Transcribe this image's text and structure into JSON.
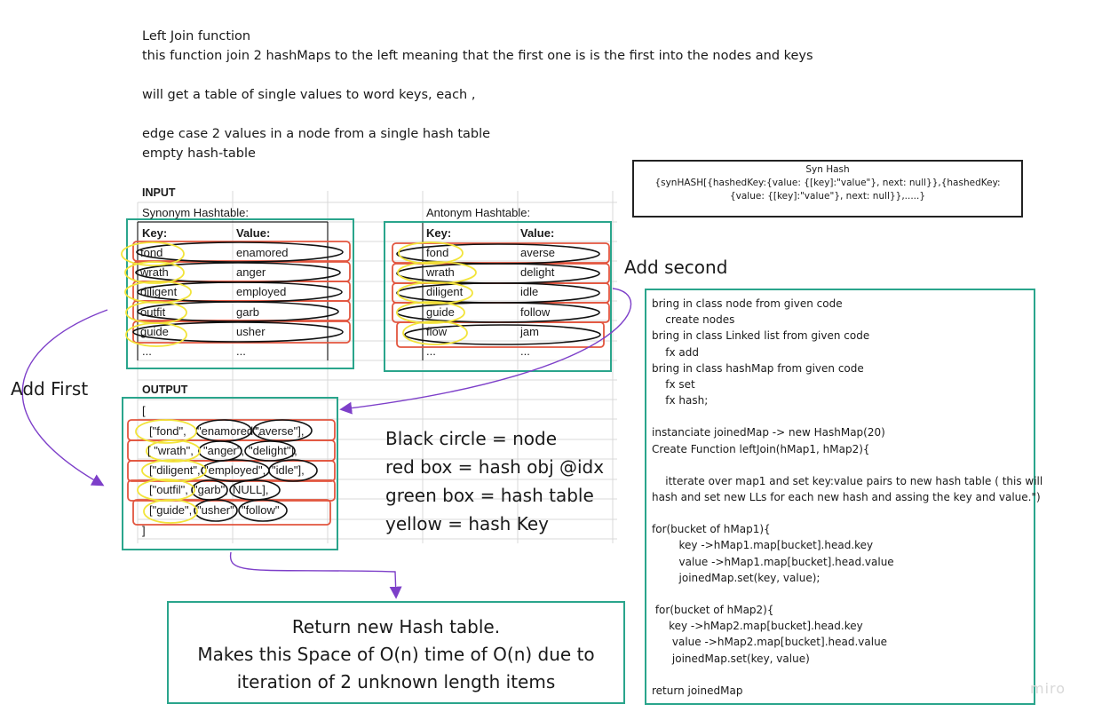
{
  "notes": [
    "Left Join function",
    "this function join 2 hashMaps to the left meaning that the first one is is the first into the nodes and keys",
    "",
    "will get a table of single values to word keys, each ,",
    "",
    "edge case 2 values in a node from a single hash table",
    "empty hash-table"
  ],
  "syn_hash_box": {
    "title": "Syn Hash",
    "body": "{synHASH[{hashedKey:{value: {[key]:\"value\"}, next: null}},{hashedKey:{value: {[key]:\"value\"}, next: null}},.....}"
  },
  "input": {
    "label": "INPUT",
    "synonym": {
      "caption": "Synonym Hashtable:",
      "headers": [
        "Key:",
        "Value:"
      ],
      "rows": [
        [
          "fond",
          "enamored"
        ],
        [
          "wrath",
          "anger"
        ],
        [
          "diligent",
          "employed"
        ],
        [
          "outfit",
          "garb"
        ],
        [
          "guide",
          "usher"
        ],
        [
          "...",
          "..."
        ]
      ]
    },
    "antonym": {
      "caption": "Antonym Hashtable:",
      "headers": [
        "Key:",
        "Value:"
      ],
      "rows": [
        [
          "fond",
          "averse"
        ],
        [
          "wrath",
          "delight"
        ],
        [
          "diligent",
          "idle"
        ],
        [
          "guide",
          "follow"
        ],
        [
          "flow",
          "jam"
        ],
        [
          "...",
          "..."
        ]
      ]
    }
  },
  "output": {
    "label": "OUTPUT",
    "open": "[",
    "close": "]",
    "rows": [
      [
        "[\"fond\",",
        "\"enamored\",",
        "\"averse\"],"
      ],
      [
        "[ \"wrath\",",
        "\"anger\",",
        "\"delight\"],"
      ],
      [
        "[\"diligent\",",
        "\"employed\",",
        "\"idle\"],"
      ],
      [
        "[\"outfil\",",
        "\"garb\",",
        "NULL],"
      ],
      [
        "[\"guide\",",
        "\"usher\"",
        "\"follow\""
      ]
    ]
  },
  "arrow_labels": {
    "add_first": "Add First",
    "add_second": "Add second"
  },
  "legend": [
    "Black circle  = node",
    "red box = hash obj @idx",
    "green box = hash table",
    "yellow = hash Key"
  ],
  "return_box": [
    "Return new Hash table.",
    "Makes this Space of O(n) time of O(n) due to",
    "iteration of 2 unknown length items"
  ],
  "code_lines": [
    "bring in class node from given code",
    "    create nodes",
    "bring in class Linked list from given code",
    "    fx add",
    "bring in class hashMap from given code",
    "    fx set",
    "    fx hash;",
    "",
    "instanciate joinedMap -> new HashMap(20)",
    "Create Function leftJoin(hMap1, hMap2){",
    "",
    "    itterate over map1 and set key:value pairs to new hash table ( this will",
    "hash and set new LLs for each new hash and assing the key and value.\")",
    "",
    "for(bucket of hMap1){",
    "        key ->hMap1.map[bucket].head.key",
    "        value ->hMap1.map[bucket].head.value",
    "        joinedMap.set(key, value);",
    "",
    " for(bucket of hMap2){",
    "     key ->hMap2.map[bucket].head.key",
    "      value ->hMap2.map[bucket].head.value",
    "      joinedMap.set(key, value)",
    "",
    "return joinedMap"
  ],
  "watermark": "miro",
  "colors": {
    "green": "#2aa58c",
    "red": "#e2553f",
    "yellow": "#f2e43a",
    "purple": "#7d3fc9",
    "black": "#111111"
  }
}
